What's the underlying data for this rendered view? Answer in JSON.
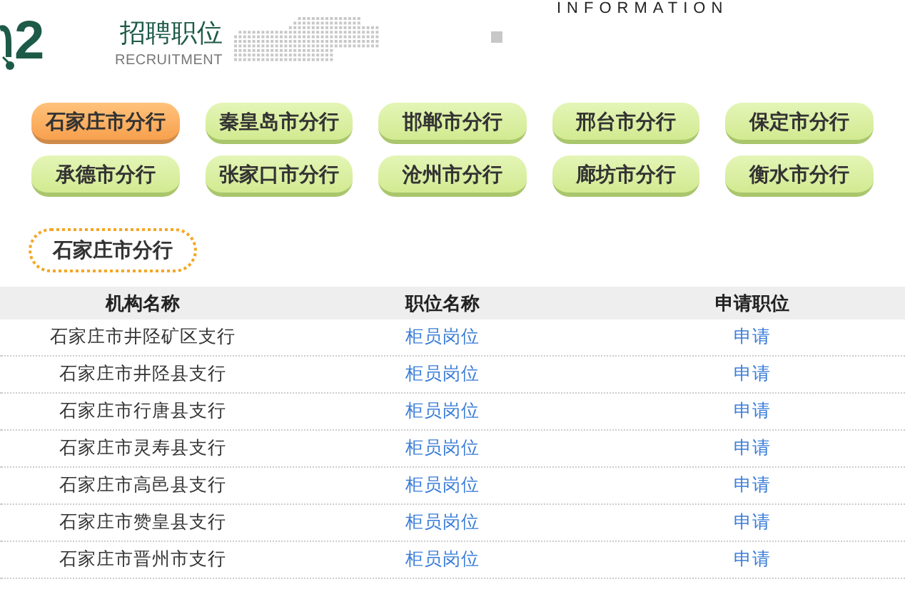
{
  "header": {
    "number": "2",
    "english_top": "INFORMATION",
    "title": "招聘职位",
    "subtitle": "RECRUITMENT"
  },
  "branches": [
    {
      "label": "石家庄市分行",
      "selected": true
    },
    {
      "label": "秦皇岛市分行",
      "selected": false
    },
    {
      "label": "邯郸市分行",
      "selected": false
    },
    {
      "label": "邢台市分行",
      "selected": false
    },
    {
      "label": "保定市分行",
      "selected": false
    },
    {
      "label": "承德市分行",
      "selected": false
    },
    {
      "label": "张家口市分行",
      "selected": false
    },
    {
      "label": "沧州市分行",
      "selected": false
    },
    {
      "label": "廊坊市分行",
      "selected": false
    },
    {
      "label": "衡水市分行",
      "selected": false
    }
  ],
  "current_branch": "石家庄市分行",
  "table": {
    "columns": [
      "机构名称",
      "职位名称",
      "申请职位"
    ],
    "rows": [
      {
        "org": "石家庄市井陉矿区支行",
        "position": "柜员岗位",
        "apply": "申请"
      },
      {
        "org": "石家庄市井陉县支行",
        "position": "柜员岗位",
        "apply": "申请"
      },
      {
        "org": "石家庄市行唐县支行",
        "position": "柜员岗位",
        "apply": "申请"
      },
      {
        "org": "石家庄市灵寿县支行",
        "position": "柜员岗位",
        "apply": "申请"
      },
      {
        "org": "石家庄市高邑县支行",
        "position": "柜员岗位",
        "apply": "申请"
      },
      {
        "org": "石家庄市赞皇县支行",
        "position": "柜员岗位",
        "apply": "申请"
      },
      {
        "org": "石家庄市晋州市支行",
        "position": "柜员岗位",
        "apply": "申请"
      }
    ]
  }
}
